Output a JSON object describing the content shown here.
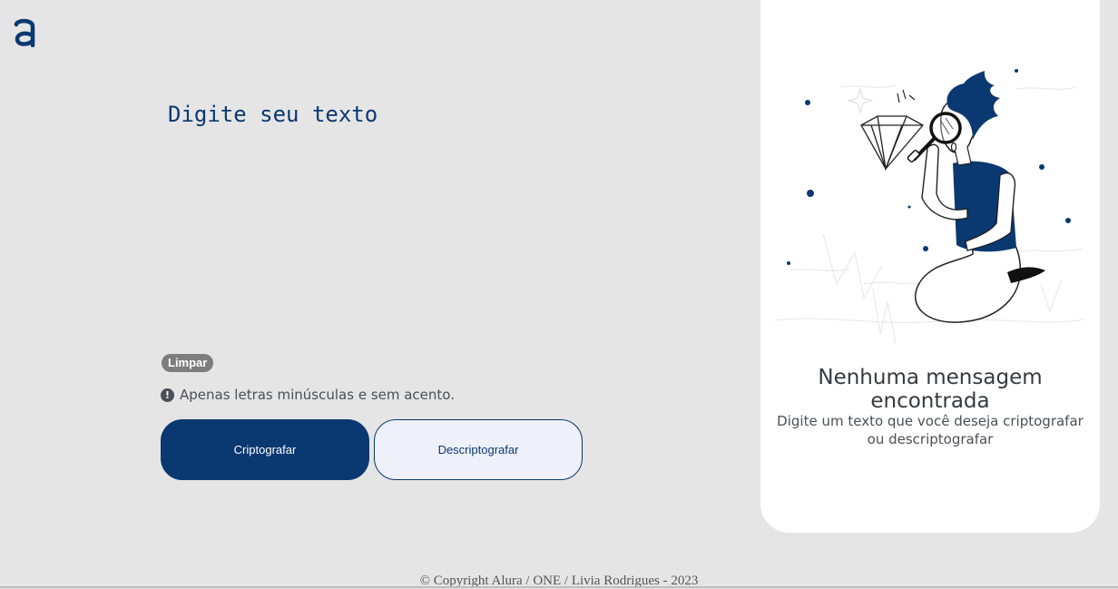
{
  "header": {
    "logo_icon": "alura-logo-icon"
  },
  "input": {
    "placeholder": "Digite seu texto",
    "value": ""
  },
  "controls": {
    "clear_label": "Limpar",
    "hint_icon": "exclamation-circle-icon",
    "hint_text": "Apenas letras minúsculas e sem acento.",
    "encrypt_label": "Criptografar",
    "decrypt_label": "Descriptografar"
  },
  "output": {
    "illustration": "person-with-magnifying-glass-illustration",
    "title": "Nenhuma mensagem encontrada",
    "subtitle": "Digite um texto que você deseja criptografar ou descriptografar"
  },
  "footer": {
    "text": "© Copyright Alura / ONE / Livia Rodrigues - 2023"
  },
  "colors": {
    "background": "#e5e5e5",
    "primary": "#0a3871",
    "secondary_button_bg": "#eef1fa",
    "panel_bg": "#ffffff",
    "clear_button_bg": "#7d7d7d"
  }
}
